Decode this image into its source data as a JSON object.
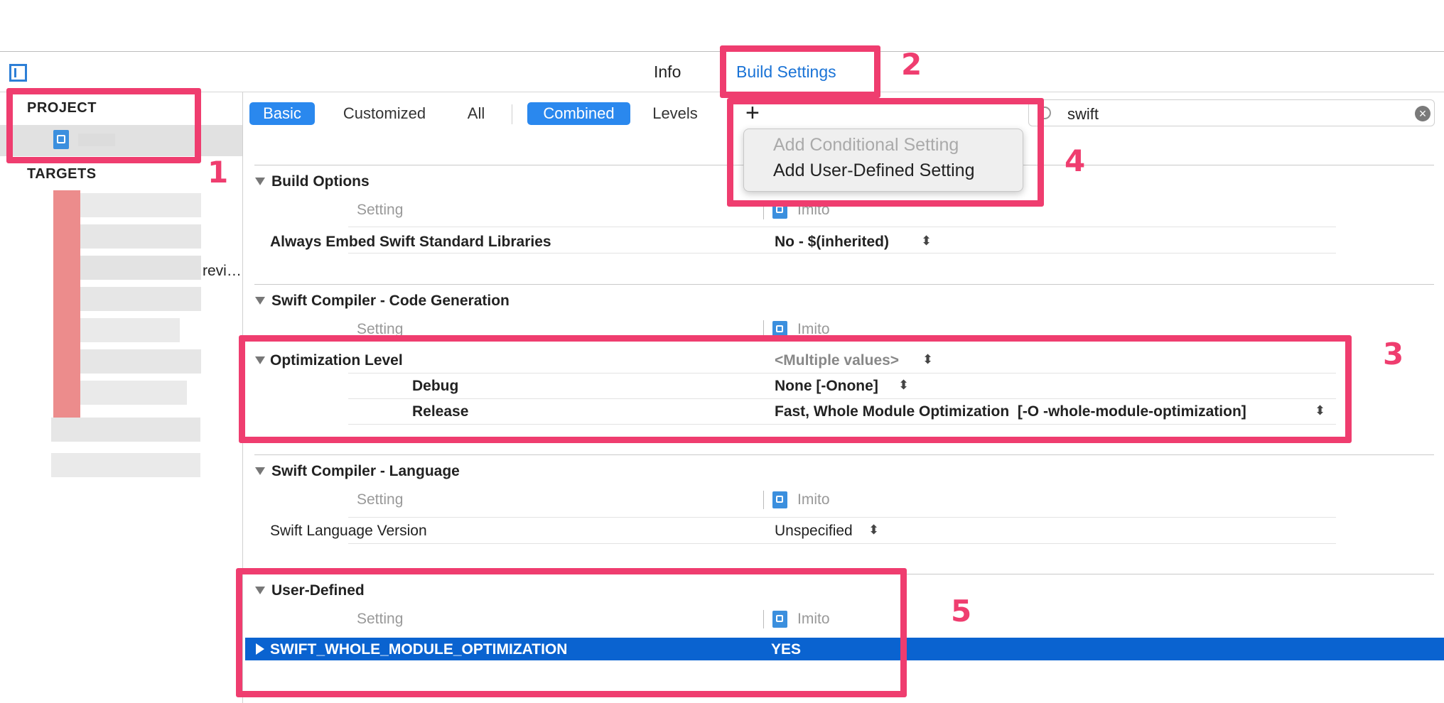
{
  "tabs": {
    "info": "Info",
    "build_settings": "Build Settings"
  },
  "sidebar": {
    "project_header": "PROJECT",
    "targets_header": "TARGETS",
    "truncated_target": "revi…"
  },
  "filter": {
    "basic": "Basic",
    "customized": "Customized",
    "all": "All",
    "combined": "Combined",
    "levels": "Levels"
  },
  "search": {
    "value": "swift",
    "clear": "×"
  },
  "add_menu": {
    "plus": "+",
    "conditional": "Add Conditional Setting",
    "user_defined": "Add User-Defined Setting"
  },
  "columns": {
    "setting": "Setting",
    "target": "Imito"
  },
  "groups": {
    "build_options": {
      "title": "Build Options",
      "rows": [
        {
          "name": "Always Embed Swift Standard Libraries",
          "value": "No  -  $(inherited)"
        }
      ]
    },
    "codegen": {
      "title": "Swift Compiler - Code Generation",
      "optimization": {
        "name": "Optimization Level",
        "value": "<Multiple values>",
        "debug_name": "Debug",
        "debug_value": "None [-Onone]",
        "release_name": "Release",
        "release_value": "Fast, Whole Module Optimization  [-O -whole-module-optimization]"
      }
    },
    "language": {
      "title": "Swift Compiler - Language",
      "rows": [
        {
          "name": "Swift Language Version",
          "value": "Unspecified"
        }
      ]
    },
    "user_defined": {
      "title": "User-Defined",
      "rows": [
        {
          "name": "SWIFT_WHOLE_MODULE_OPTIMIZATION",
          "value": "YES"
        }
      ]
    }
  },
  "annotations": [
    "1",
    "2",
    "3",
    "4",
    "5"
  ],
  "colors": {
    "highlight": "#ef3d6f",
    "selection": "#0a63d0",
    "accent": "#2a88ee"
  }
}
